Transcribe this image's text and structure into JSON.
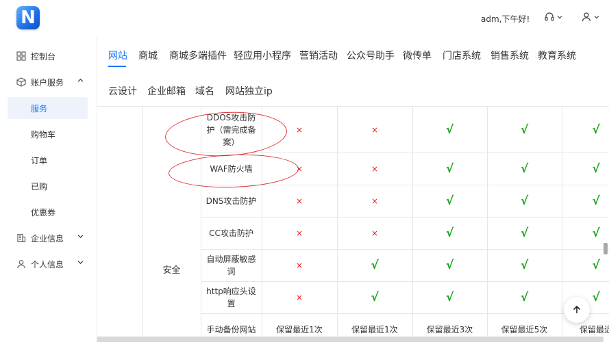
{
  "header": {
    "logo_letter": "N",
    "greeting": "adm,下午好!"
  },
  "sidebar": {
    "items": [
      {
        "label": "控制台",
        "icon": "dashboard-icon"
      },
      {
        "label": "账户服务",
        "icon": "cube-icon",
        "expanded": true
      },
      {
        "label": "服务",
        "active": true
      },
      {
        "label": "购物车"
      },
      {
        "label": "订单"
      },
      {
        "label": "已购"
      },
      {
        "label": "优惠券"
      },
      {
        "label": "企业信息",
        "icon": "building-icon"
      },
      {
        "label": "个人信息",
        "icon": "user-icon"
      }
    ]
  },
  "tabs": {
    "row1": [
      "网站",
      "商城",
      "商城多端插件",
      "轻应用小程序",
      "营销活动",
      "公众号助手",
      "微传单",
      "门店系统",
      "销售系统",
      "教育系统"
    ],
    "row2": [
      "云设计",
      "企业邮箱",
      "域名",
      "网站独立ip"
    ],
    "active": "网站"
  },
  "table": {
    "category": "安全",
    "rows": [
      {
        "feature": "DDOS攻击防护（需完成备案）",
        "values": [
          "cross",
          "cross",
          "check",
          "check",
          "check"
        ]
      },
      {
        "feature": "WAF防火墙",
        "values": [
          "cross",
          "cross",
          "check",
          "check",
          "check"
        ]
      },
      {
        "feature": "DNS攻击防护",
        "values": [
          "cross",
          "cross",
          "check",
          "check",
          "check"
        ]
      },
      {
        "feature": "CC攻击防护",
        "values": [
          "cross",
          "cross",
          "check",
          "check",
          "check"
        ]
      },
      {
        "feature": "自动屏蔽敏感词",
        "values": [
          "cross",
          "check",
          "check",
          "check",
          "check"
        ]
      },
      {
        "feature": "http响应头设置",
        "values": [
          "cross",
          "check",
          "check",
          "check",
          "check"
        ]
      },
      {
        "feature": "手动备份网站",
        "values": [
          "保留最近1次",
          "保留最近1次",
          "保留最近3次",
          "保留最近5次",
          "保留最近"
        ]
      }
    ],
    "symbols": {
      "cross": "×",
      "check": "√"
    }
  },
  "colors": {
    "accent": "#1677ff",
    "cross": "#e02020",
    "check": "#17a517",
    "annotation": "#d9373b"
  }
}
